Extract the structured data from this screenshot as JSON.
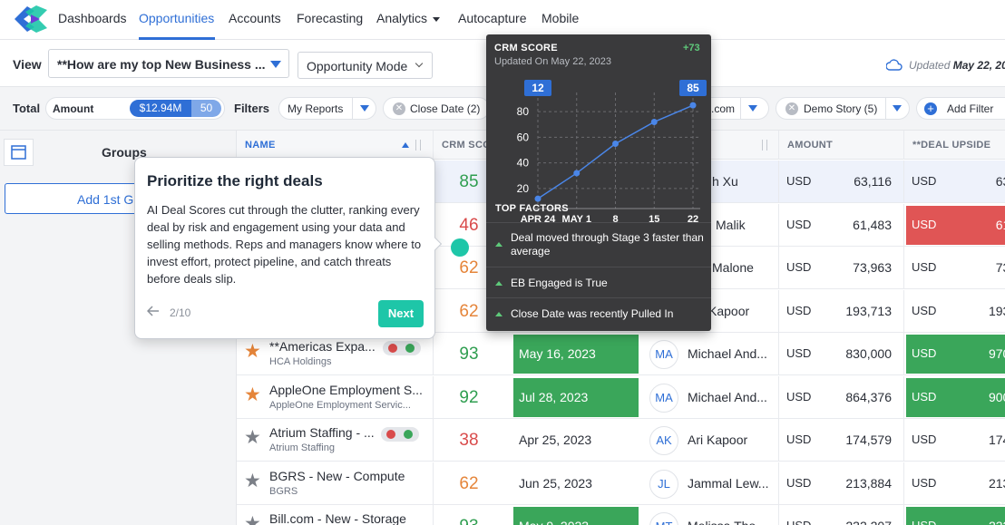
{
  "nav": {
    "items": [
      "Dashboards",
      "Opportunities",
      "Accounts",
      "Forecasting",
      "Analytics",
      "Autocapture",
      "Mobile"
    ],
    "active": "Opportunities"
  },
  "viewbar": {
    "label": "View",
    "selected_view": "**How are my top New Business ...",
    "mode": "Opportunity Mode",
    "updated_prefix": "Updated",
    "updated_date": "May 22, 20"
  },
  "filterbar": {
    "total_label": "Total",
    "amount_label": "Amount",
    "amount_value": "$12.94M",
    "amount_count": "50",
    "filters_label": "Filters",
    "filters": [
      {
        "label": "My Reports"
      },
      {
        "label": "Close Date (2)"
      },
      {
        "label": ".com"
      },
      {
        "label": "Demo Story (5)"
      }
    ],
    "add_filter": "Add Filter"
  },
  "groups": {
    "title": "Groups",
    "add_label": "Add 1st Gr"
  },
  "table": {
    "columns": {
      "name": "NAME",
      "crm": "CRM SCOR",
      "amount": "AMOUNT",
      "upside": "**DEAL UPSIDE"
    },
    "rows": [
      {
        "star": "",
        "name": "",
        "sub": "",
        "score": "85",
        "score_color": "green",
        "date": "",
        "date_green": false,
        "initials": "",
        "owner": "h Xu",
        "currency": "USD",
        "amount": "63,116",
        "upside_currency": "USD",
        "upside": "63,1",
        "upside_color": "none",
        "highlight": true,
        "badges": false
      },
      {
        "star": "",
        "name": "",
        "sub": "",
        "score": "46",
        "score_color": "red",
        "date": "",
        "date_green": false,
        "initials": "",
        "owner": "Malik",
        "currency": "USD",
        "amount": "61,483",
        "upside_currency": "USD",
        "upside": "61,4",
        "upside_color": "red",
        "highlight": false,
        "badges": false
      },
      {
        "star": "",
        "name": "",
        "sub": "",
        "score": "62",
        "score_color": "orange",
        "date": "",
        "date_green": false,
        "initials": "",
        "owner": "Malone",
        "currency": "USD",
        "amount": "73,963",
        "upside_currency": "USD",
        "upside": "73,9",
        "upside_color": "none",
        "highlight": false,
        "badges": false
      },
      {
        "star": "",
        "name": "",
        "sub": "",
        "score": "62",
        "score_color": "orange",
        "date": "",
        "date_green": false,
        "initials": "",
        "owner": "Kapoor",
        "currency": "USD",
        "amount": "193,713",
        "upside_currency": "USD",
        "upside": "193,7",
        "upside_color": "none",
        "highlight": false,
        "badges": false
      },
      {
        "star": "orange",
        "name": "**Americas Expa...",
        "sub": "HCA Holdings",
        "score": "93",
        "score_color": "green",
        "date": "May 16, 2023",
        "date_green": true,
        "initials": "MA",
        "owner": "Michael And...",
        "currency": "USD",
        "amount": "830,000",
        "upside_currency": "USD",
        "upside": "970,0",
        "upside_color": "green",
        "highlight": false,
        "badges": true
      },
      {
        "star": "orange",
        "name": "AppleOne Employment S...",
        "sub": "AppleOne Employment Servic...",
        "score": "92",
        "score_color": "green",
        "date": "Jul 28, 2023",
        "date_green": true,
        "initials": "MA",
        "owner": "Michael And...",
        "currency": "USD",
        "amount": "864,376",
        "upside_currency": "USD",
        "upside": "900,0",
        "upside_color": "green",
        "highlight": false,
        "badges": false
      },
      {
        "star": "gray",
        "name": "Atrium Staffing - ...",
        "sub": "Atrium Staffing",
        "score": "38",
        "score_color": "red",
        "date": "Apr 25, 2023",
        "date_green": false,
        "initials": "AK",
        "owner": "Ari Kapoor",
        "currency": "USD",
        "amount": "174,579",
        "upside_currency": "USD",
        "upside": "174,5",
        "upside_color": "none",
        "highlight": false,
        "badges": true
      },
      {
        "star": "gray",
        "name": "BGRS - New - Compute",
        "sub": "BGRS",
        "score": "62",
        "score_color": "orange",
        "date": "Jun 25, 2023",
        "date_green": false,
        "initials": "JL",
        "owner": "Jammal Lew...",
        "currency": "USD",
        "amount": "213,884",
        "upside_currency": "USD",
        "upside": "213,8",
        "upside_color": "none",
        "highlight": false,
        "badges": false
      },
      {
        "star": "gray",
        "name": "Bill.com - New - Storage",
        "sub": "",
        "score": "93",
        "score_color": "green",
        "date": "May 9, 2023",
        "date_green": true,
        "initials": "MT",
        "owner": "Melissa Tho...",
        "currency": "USD",
        "amount": "232,207",
        "upside_currency": "USD",
        "upside": "232,2",
        "upside_color": "green",
        "highlight": false,
        "badges": false
      }
    ]
  },
  "tour": {
    "title": "Prioritize the right deals",
    "body": "AI Deal Scores cut through the clutter, ranking every deal by risk and engagement using your data and selling methods. Reps and managers know where to invest effort, protect pipeline, and catch threats before deals slip.",
    "back_icon": "arrow-left-icon",
    "step": "2/10",
    "next_label": "Next"
  },
  "crm_tooltip": {
    "title": "CRM SCORE",
    "delta": "+73",
    "updated": "Updated On May 22, 2023",
    "factors_title": "TOP FACTORS",
    "factors": [
      "Deal moved through Stage 3 faster than average",
      "EB Engaged is True",
      "Close Date was recently Pulled In"
    ]
  },
  "chart_data": {
    "type": "line",
    "categories": [
      "APR 24",
      "MAY 1",
      "8",
      "15",
      "22"
    ],
    "x": [
      0,
      1,
      2,
      3,
      4,
      5,
      6
    ],
    "values": [
      12,
      32,
      55,
      72,
      85
    ],
    "series": [
      {
        "values": [
          12,
          32,
          55,
          72,
          85
        ]
      }
    ],
    "start_label": "12",
    "end_label": "85",
    "yticks": [
      20,
      40,
      60,
      80
    ],
    "ylim": [
      10,
      95
    ],
    "grid": true,
    "title": "",
    "xlabel": "",
    "ylabel": ""
  },
  "colors": {
    "accent": "#2f6fd6",
    "teal": "#1ec6a8",
    "green": "#3aa65a",
    "red": "#e05555",
    "orange": "#e5853a"
  }
}
